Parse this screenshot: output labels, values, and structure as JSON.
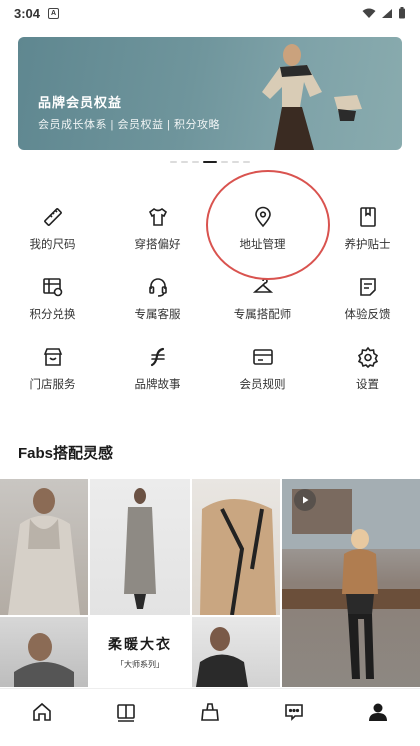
{
  "status_bar": {
    "time": "3:04",
    "notif_letter": "A"
  },
  "banner": {
    "title": "品牌会员权益",
    "subtitle": "会员成长体系 | 会员权益 | 积分攻略"
  },
  "grid": [
    {
      "label": "我的尺码",
      "icon": "ruler-icon"
    },
    {
      "label": "穿搭偏好",
      "icon": "tshirt-icon"
    },
    {
      "label": "地址管理",
      "icon": "location-pin-icon"
    },
    {
      "label": "养护贴士",
      "icon": "notebook-icon"
    },
    {
      "label": "积分兑换",
      "icon": "points-exchange-icon"
    },
    {
      "label": "专属客服",
      "icon": "headset-icon"
    },
    {
      "label": "专属搭配师",
      "icon": "stylist-icon"
    },
    {
      "label": "体验反馈",
      "icon": "feedback-icon"
    },
    {
      "label": "门店服务",
      "icon": "store-icon"
    },
    {
      "label": "品牌故事",
      "icon": "brand-story-icon"
    },
    {
      "label": "会员规则",
      "icon": "member-card-icon"
    },
    {
      "label": "设置",
      "icon": "gear-icon"
    }
  ],
  "section": {
    "title": "Fabs搭配灵感"
  },
  "promo_tile": {
    "title": "柔暖大衣",
    "subtitle": "「大师系列」"
  },
  "tabs": [
    "home-icon",
    "catalog-icon",
    "shopping-bag-icon",
    "message-icon",
    "profile-icon"
  ],
  "colors": {
    "accent_dark": "#1f1f1f",
    "highlight": "#d9534f",
    "banner": "#6f959c"
  }
}
